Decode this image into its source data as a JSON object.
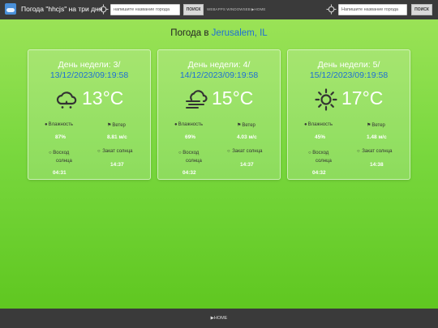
{
  "header": {
    "app_title": "Погода \"hhcjs\" на три дня",
    "search_left": {
      "placeholder": "напишите название города",
      "button": "ПОИСК"
    },
    "nav": {
      "webapp": "WEBAPPS WINDOWSEB",
      "home": "▶HOME"
    },
    "search_right": {
      "placeholder": "Напишите название города",
      "button": "ПОИСК"
    }
  },
  "headline": {
    "prefix": "Погода в",
    "city": "Jerusalem, IL"
  },
  "cards": [
    {
      "day": "День недели: 3/",
      "date": "13/12/2023/09:19:58",
      "icon": "cloud-rain-icon",
      "temp": "13°C",
      "humidity_label": "Влажность",
      "humidity": "87%",
      "wind_label": "Ветер",
      "wind": "8.81 м/с",
      "sunrise_label_1": "Восход",
      "sunrise_label_2": "солнца",
      "sunrise": "04:31",
      "sunset_label": "Закат солнца",
      "sunset": "14:37"
    },
    {
      "day": "День недели: 4/",
      "date": "14/12/2023/09:19:58",
      "icon": "cloud-wind-icon",
      "temp": "15°C",
      "humidity_label": "Влажность",
      "humidity": "69%",
      "wind_label": "Ветер",
      "wind": "4.03 м/с",
      "sunrise_label_1": "Восход",
      "sunrise_label_2": "солнца",
      "sunrise": "04:32",
      "sunset_label": "Закат солнца",
      "sunset": "14:37"
    },
    {
      "day": "День недели: 5/",
      "date": "15/12/2023/09:19:58",
      "icon": "sun-icon",
      "temp": "17°C",
      "humidity_label": "Влажность",
      "humidity": "45%",
      "wind_label": "Ветер",
      "wind": "1.48 м/с",
      "sunrise_label_1": "Восход",
      "sunrise_label_2": "солнца",
      "sunrise": "04:32",
      "sunset_label": "Закат солнца",
      "sunset": "14:38"
    }
  ],
  "footer": {
    "home": "▶HOME"
  },
  "colors": {
    "topbar": "#3a3a3a",
    "accent_blue": "#1e6fd6",
    "bg_green": "#7ad83f"
  }
}
